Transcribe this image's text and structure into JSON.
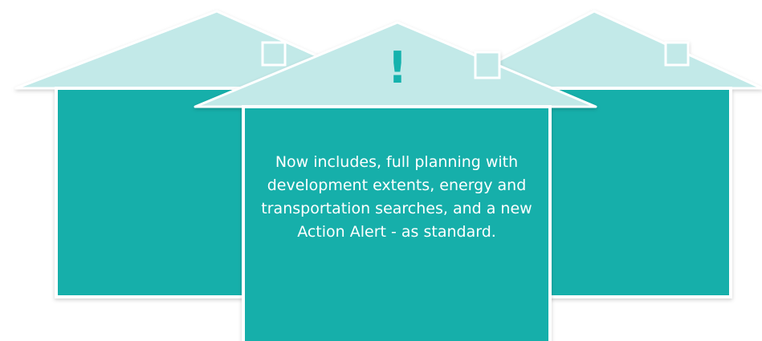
{
  "message": "Now includes, full planning with development extents, energy and transportation searches, and a new Action Alert - as standard.",
  "alert_symbol": "!",
  "colors": {
    "roof": "#c2e9e8",
    "wall": "#14afaa",
    "outline": "#ffffff",
    "accent": "#15b2ad"
  },
  "icons": [
    "exclamation-icon",
    "chimney-icon"
  ]
}
